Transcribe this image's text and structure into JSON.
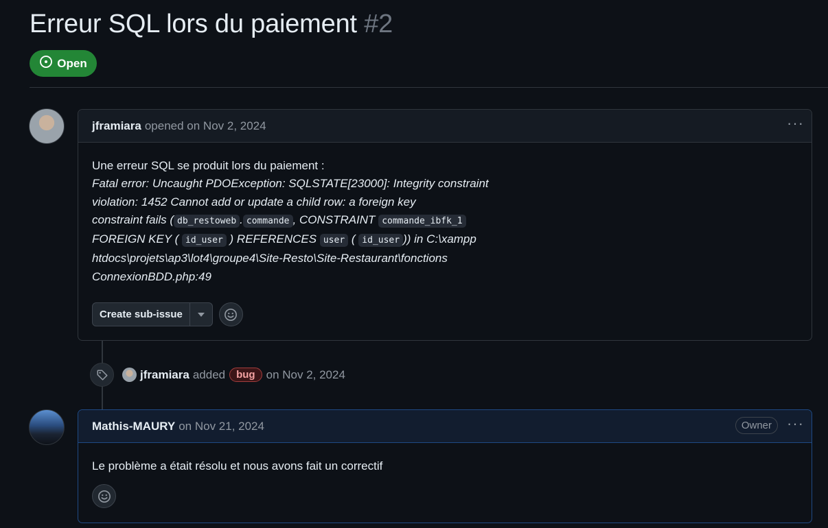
{
  "issue": {
    "title": "Erreur SQL lors du paiement",
    "number": "#2",
    "state": "Open"
  },
  "comments": [
    {
      "author": "jframiara",
      "action": "opened on Nov 2, 2024",
      "menu": "···",
      "body": {
        "intro": "Une erreur SQL se produit lors du paiement :",
        "error_part1": "Fatal error: Uncaught PDOException: SQLSTATE[23000]: Integrity constraint",
        "error_part2": "violation: 1452 Cannot add or update a child row: a foreign key",
        "error_part3": "constraint fails (",
        "code_db": "db_restoweb",
        "dot": ".",
        "code_table": "commande",
        "error_part4": ", CONSTRAINT",
        "code_constraint": "commande_ibfk_1",
        "error_part5": "FOREIGN KEY (",
        "code_fk": "id_user",
        "error_part6": ") REFERENCES",
        "code_ref_table": "user",
        "error_part7": "(",
        "code_ref_col": "id_user",
        "error_part8": ")) in C:\\xampp",
        "error_part9": "htdocs\\projets\\ap3\\lot4\\groupe4\\Site-Resto\\Site-Restaurant\\fonctions",
        "error_part10": "ConnexionBDD.php:49"
      },
      "create_subissue_label": "Create sub-issue"
    },
    {
      "author": "Mathis-MAURY",
      "action": "on Nov 21, 2024",
      "badge": "Owner",
      "menu": "···",
      "body": {
        "text": "Le problème a était résolu et nous avons fait un correctif"
      }
    }
  ],
  "event": {
    "author": "jframiara",
    "verb": "added",
    "label": "bug",
    "date": "on Nov 2, 2024",
    "label_color": "#f85149"
  },
  "icons": {
    "state": "issue-opened-icon",
    "event": "tag-icon",
    "reaction": "smiley-icon",
    "dropdown": "triangle-down-icon",
    "menu": "kebab-horizontal-icon"
  },
  "colors": {
    "background": "#0d1117",
    "open_state": "#238636",
    "owner_comment_border": "#1f4a85"
  }
}
